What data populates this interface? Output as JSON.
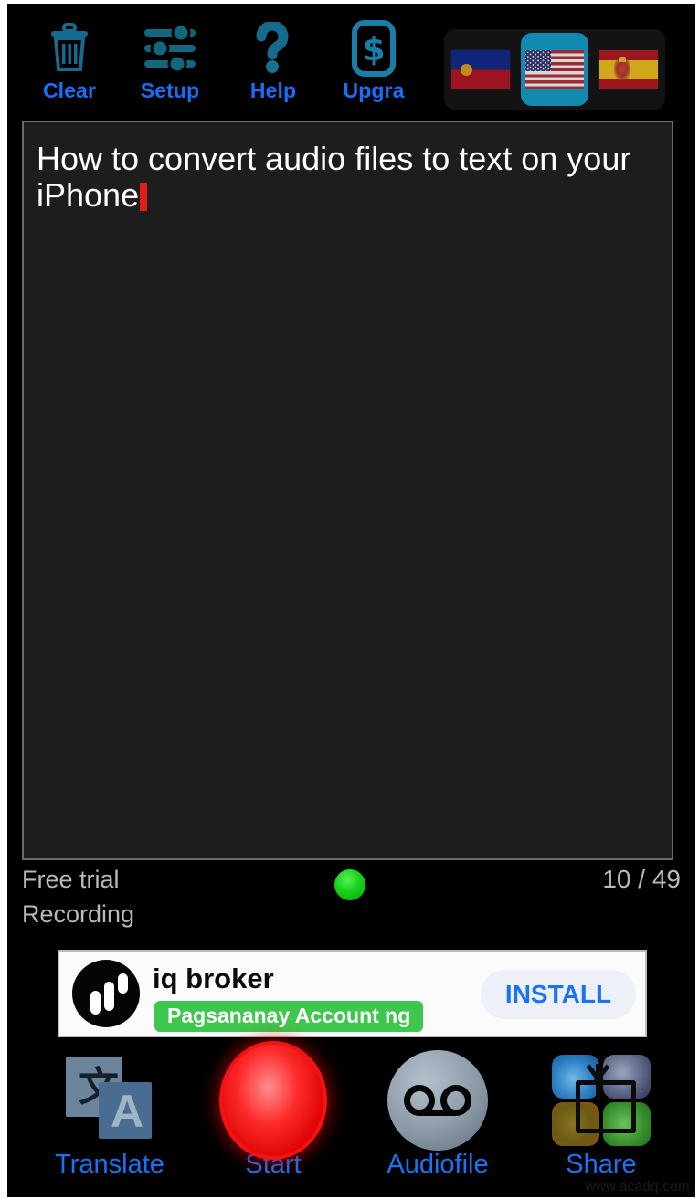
{
  "toolbar": {
    "items": [
      {
        "label": "Clear",
        "icon": "trash-icon"
      },
      {
        "label": "Setup",
        "icon": "sliders-icon"
      },
      {
        "label": "Help",
        "icon": "question-mark-icon"
      },
      {
        "label": "Upgra",
        "icon": "dollar-sign-icon"
      }
    ],
    "accent_color": "#1a6ef5"
  },
  "flags": {
    "items": [
      {
        "name": "liechtenstein",
        "selected": false
      },
      {
        "name": "united-states",
        "selected": true
      },
      {
        "name": "spain",
        "selected": false
      }
    ],
    "selected_highlight_color": "#1289b0"
  },
  "editor": {
    "text": "How to convert audio files to text on your iPhone",
    "caret_color": "#e61a1a",
    "background": "#1d1d1d",
    "border_color": "#6b6b6b"
  },
  "status": {
    "line1": "Free trial",
    "line2": "Recording",
    "counter": "10 / 49",
    "indicator": "recording-on",
    "indicator_color": "#19d119",
    "text_color": "#b9b9b9"
  },
  "ad": {
    "logo": "iq-broker-logo",
    "title": "iq broker",
    "subtitle": "Pagsananay Account ng",
    "subtitle_color": "#3ec64e",
    "cta": "INSTALL",
    "cta_color": "#1a73f5"
  },
  "bottombar": {
    "items": [
      {
        "label": "Translate",
        "icon": "translate-icon"
      },
      {
        "label": "Start",
        "icon": "record-button-icon"
      },
      {
        "label": "Audiofile",
        "icon": "cassette-tape-icon"
      },
      {
        "label": "Share",
        "icon": "share-icon"
      }
    ],
    "accent_color": "#1a72f5"
  },
  "watermark": "www.acadq.com"
}
